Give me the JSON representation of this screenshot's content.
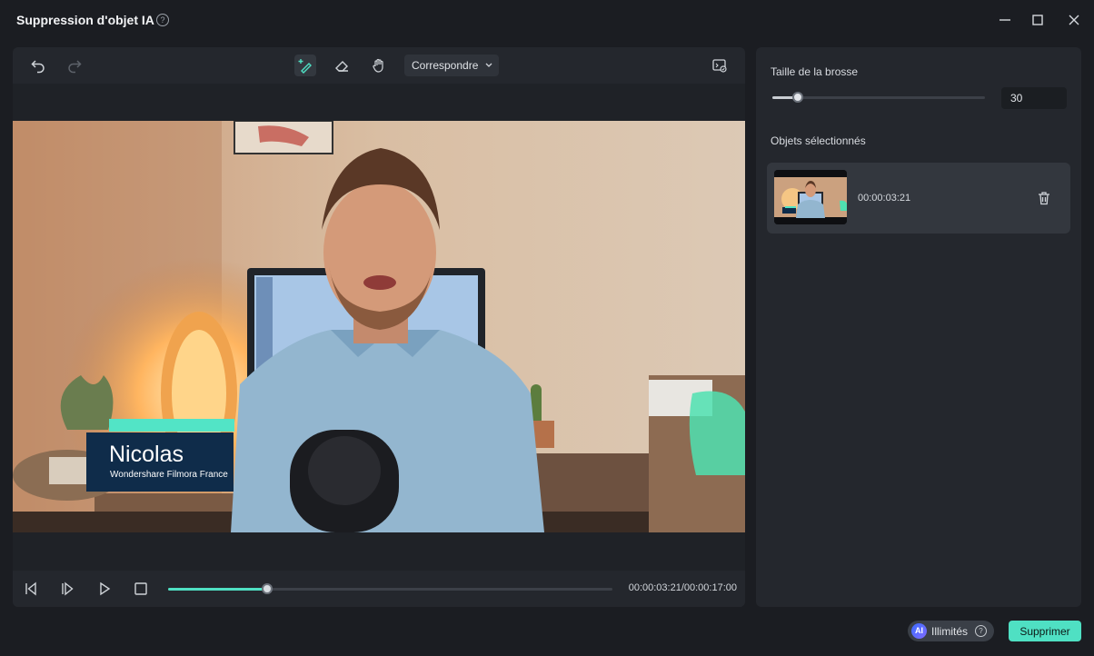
{
  "window": {
    "title": "Suppression d'objet IA",
    "help_glyph": "?"
  },
  "toolbar": {
    "mode_select": "Correspondre",
    "icons": [
      "undo-icon",
      "redo-icon",
      "brush-add-icon",
      "eraser-icon",
      "hand-icon",
      "chevron-down-icon",
      "preview-compare-icon"
    ]
  },
  "video": {
    "lower_third_name": "Nicolas",
    "lower_third_subtitle": "Wondershare Filmora France"
  },
  "playback": {
    "timecode": "00:00:03:21/00:00:17:00",
    "progress": 0.223
  },
  "panel": {
    "brush_size_label": "Taille de la brosse",
    "brush_size_value": "30",
    "brush_fraction": 0.12,
    "selected_objects_label": "Objets sélectionnés",
    "objects": [
      {
        "timecode": "00:00:03:21"
      }
    ]
  },
  "footer": {
    "ai_badge_glyph": "AI",
    "credits_label": "Illimités",
    "help_glyph": "?",
    "delete_button": "Supprimer"
  },
  "colors": {
    "accent": "#4fe0c3",
    "background": "#1b1d22",
    "panel": "#24272d",
    "selection_mask": "#4fe0b0"
  }
}
